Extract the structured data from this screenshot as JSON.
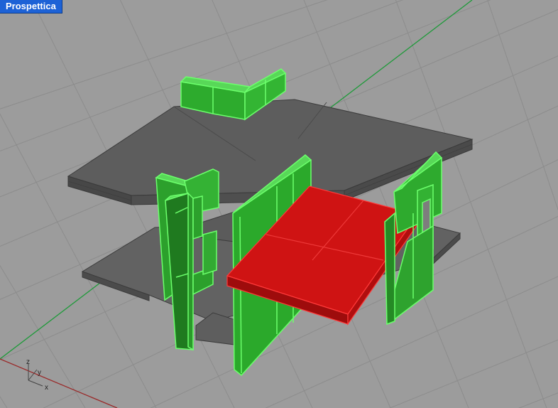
{
  "viewport": {
    "title": "Prospettica"
  },
  "axis_icon": {
    "x_label": "x",
    "y_label": "y",
    "z_label": "z"
  },
  "colors": {
    "background": "#9c9c9c",
    "grid": "#8a8a8a",
    "grid_x_axis": "#9a2b2b",
    "grid_y_axis": "#1f9a3a",
    "slab": "#5a5a5a",
    "selected_green": "#30c030",
    "selected_red": "#d01414",
    "tab": "#1d62d6"
  }
}
